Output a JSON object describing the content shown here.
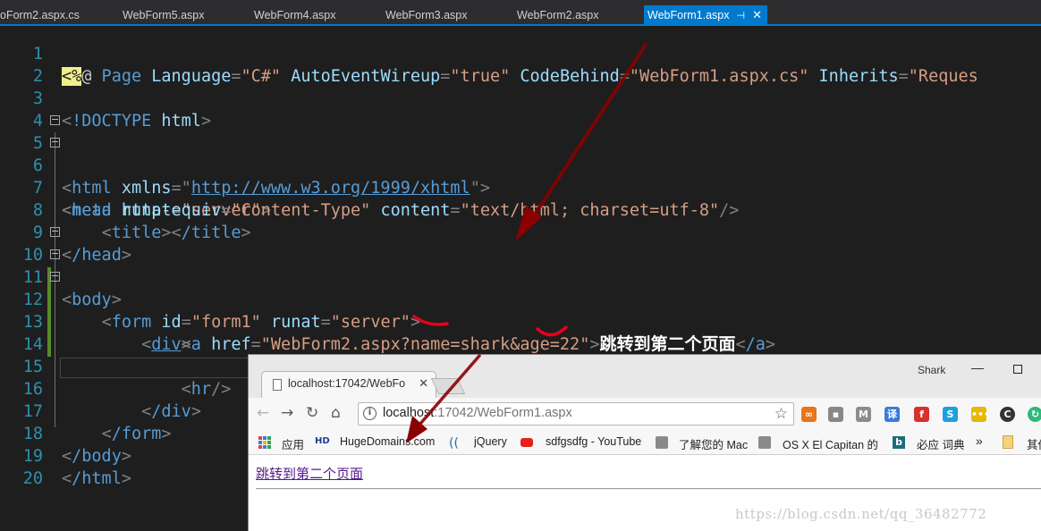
{
  "editor": {
    "tabs": [
      {
        "label": "oForm2.aspx.cs",
        "active": false
      },
      {
        "label": "WebForm5.aspx",
        "active": false
      },
      {
        "label": "WebForm4.aspx",
        "active": false
      },
      {
        "label": "WebForm3.aspx",
        "active": false
      },
      {
        "label": "WebForm2.aspx",
        "active": false
      },
      {
        "label": "WebForm1.aspx",
        "active": true
      }
    ],
    "active_tab_pin": "⊣",
    "active_tab_close": "✕",
    "line_numbers": [
      "1",
      "2",
      "3",
      "4",
      "5",
      "6",
      "7",
      "8",
      "9",
      "10",
      "11",
      "12",
      "13",
      "14",
      "15",
      "16",
      "17",
      "18",
      "19",
      "20"
    ],
    "code": {
      "l1_open": "<%",
      "l1_at": "@",
      "l1_page": " Page ",
      "l1_a1": "Language",
      "l1_v1": "\"C#\"",
      "l1_a2": "AutoEventWireup",
      "l1_v2": "\"true\"",
      "l1_a3": "CodeBehind",
      "l1_v3": "\"WebForm1.aspx.cs\"",
      "l1_a4": "Inherits",
      "l1_v4": "\"Reques",
      "l3_doctype": "!DOCTYPE",
      "l3_html": " html",
      "l5_tag": "html",
      "l5_attr": " xmlns",
      "l5_url": "http://www.w3.org/1999/xhtml",
      "l6_tag": "head",
      "l6_attr": " runat",
      "l6_val": "\"server\"",
      "l7_tag": "meta",
      "l7_a1": " http-equiv",
      "l7_v1": "\"Content-Type\"",
      "l7_a2": " content",
      "l7_v2": "\"text/html; charset=utf-8\"",
      "l8_tag": "title",
      "l8_close": "/title",
      "l9_tag": "/head",
      "l10_tag": "body",
      "l11_tag": "form",
      "l11_a1": " id",
      "l11_v1": "\"form1\"",
      "l11_a2": " runat",
      "l11_v2": "\"server\"",
      "l12_tag": "div",
      "l13_tag": "a",
      "l13_attr": " href",
      "l13_val": "\"WebForm2.aspx?name=shark&age=22\"",
      "l13_text": "跳转到第二个页面",
      "l13_close": "/a",
      "l15_tag": "hr",
      "l16_tag": "/div",
      "l17_tag": "/form",
      "l18_tag": "/body",
      "l19_tag": "/html"
    }
  },
  "browser": {
    "tab_title": "localhost:17042/WebFo",
    "tab_close": "✕",
    "profile_name": "Shark",
    "address": {
      "info_icon": "i",
      "host": "localhost",
      "rest": ":17042/WebForm1.aspx"
    },
    "nav": {
      "back": "←",
      "forward": "→",
      "reload": "↻",
      "home": "⌂",
      "star": "☆"
    },
    "extensions": [
      {
        "name": "infinity-ext-icon",
        "glyph": "∞",
        "color": "#e8741c"
      },
      {
        "name": "puzzle-ext-icon",
        "glyph": "▪",
        "color": "#888888"
      },
      {
        "name": "gmail-ext-icon",
        "glyph": "M",
        "color": "#8c8c8c"
      },
      {
        "name": "translate-ext-icon",
        "glyph": "译",
        "color": "#3b7bd8"
      },
      {
        "name": "flash-ext-icon",
        "glyph": "f",
        "color": "#d9302c"
      },
      {
        "name": "skype-ext-icon",
        "glyph": "S",
        "color": "#1aa0e0"
      },
      {
        "name": "chat-ext-icon",
        "glyph": "•••",
        "color": "#e6b800"
      },
      {
        "name": "c-ext-icon",
        "glyph": "C",
        "color": "#333333"
      },
      {
        "name": "refresh-ext-icon",
        "glyph": "↻",
        "color": "#2eb87a"
      }
    ],
    "bookmarks": {
      "apps": "应用",
      "items": [
        {
          "label": "HugeDomains.com",
          "icon": "hd-icon"
        },
        {
          "label": "jQuery",
          "icon": "jquery-icon"
        },
        {
          "label": "sdfgsdfg - YouTube",
          "icon": "youtube-icon"
        },
        {
          "label": "了解您的 Mac",
          "icon": "apple-icon"
        },
        {
          "label": "OS X El Capitan 的",
          "icon": "apple-icon"
        },
        {
          "label": "必应 词典",
          "icon": "bing-icon"
        }
      ],
      "more": "»",
      "other": "其他"
    },
    "page": {
      "link_text": "跳转到第二个页面"
    }
  },
  "watermark": "https://blog.csdn.net/qq_36482772",
  "colors": {
    "accent": "#007acc",
    "annotation_arrow": "#8b0000",
    "annotation_scribble": "#e8001c"
  }
}
